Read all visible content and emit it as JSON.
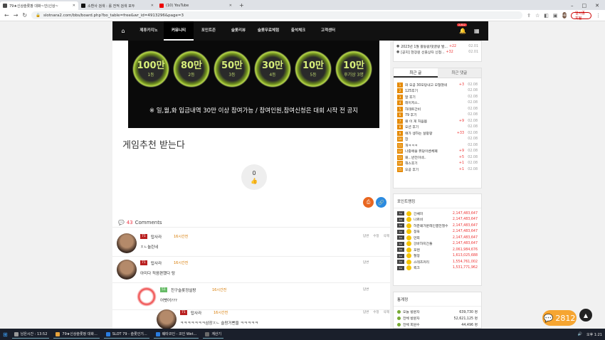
{
  "browser": {
    "tabs": [
      {
        "title": "79★신상슬롯팡 대화~인(신상~",
        "fav": "#4a4a4a",
        "active": true
      },
      {
        "title": "소환사 검색 : 롤 전적 검색 포두",
        "fav": "#111",
        "active": false
      },
      {
        "title": "(10) YouTube",
        "fav": "#e00",
        "active": false
      }
    ],
    "new_tab": "+",
    "url": "slotnara2.com/bbs/board.php?bo_table=free&wr_id=4913296&page=3",
    "profile": "HB",
    "pause_label": "일시중지됨"
  },
  "menu": {
    "home": "⌂",
    "items": [
      "제휴카지노",
      "커뮤니티",
      "포인트존",
      "슬롯리뷰",
      "슬롯무료체험",
      "출석체크",
      "고객센터"
    ],
    "active_index": 1,
    "bell_badge": "2,812",
    "grid": "▦"
  },
  "banner": {
    "coins": [
      {
        "amount": "100만",
        "rank": "1등"
      },
      {
        "amount": "80만",
        "rank": "2등"
      },
      {
        "amount": "50만",
        "rank": "3등"
      },
      {
        "amount": "30만",
        "rank": "4등"
      },
      {
        "amount": "10만",
        "rank": "5등"
      },
      {
        "amount": "10만",
        "rank": "후기상 3명"
      }
    ],
    "note": "※ 일,월,화 입금내역 30만 이상 참여가능 / 참여인원,참여신청은 대회 시작 전 공지"
  },
  "post": {
    "title": "게임추천 받는다",
    "like_count": "0"
  },
  "comments": {
    "count": "43",
    "label": "Comments",
    "items": [
      {
        "lvl": "71",
        "nick": "탑사라",
        "time": "16시간전",
        "text": "ㅈㄴ놀린네",
        "actions": [
          "답변",
          "수정",
          "삭제"
        ]
      },
      {
        "lvl": "71",
        "nick": "탑사라",
        "time": "16시간전",
        "text": "아미다 적음편했다 탕",
        "actions": [
          "답변"
        ]
      },
      {
        "lvl": "51",
        "nick": "친구슬롯정설팡",
        "time": "16시간전",
        "text": "어뻣어???",
        "actions": [
          "답변"
        ]
      },
      {
        "lvl": "71",
        "nick": "탑사라",
        "time": "16시간전",
        "text": "ㅋㅋㅋㅋㅋㅋㅋ삼장ㅈㄴ 슬랑거뻔을 ㅋㅋㅋㅋㅋ",
        "actions": [
          "답변",
          "수정",
          "삭제"
        ]
      }
    ]
  },
  "notices": [
    {
      "title": "2023년 1월 활동왕/댓글왕 발...",
      "count": "+22",
      "date": "02.01"
    },
    {
      "title": "[공지] 현장원 선출상자 신청...",
      "count": "+32",
      "date": "02.01"
    }
  ],
  "popular": {
    "tabs": [
      "최근 글",
      "최근 댓글"
    ],
    "items": [
      {
        "rank": "1",
        "title": "와 오공 30모탕내고 모형졌네",
        "count": "+3",
        "date": "02.08"
      },
      {
        "rank": "2",
        "title": "125후기",
        "count": "",
        "date": "02.08"
      },
      {
        "rank": "3",
        "title": "알 후기",
        "count": "",
        "date": "02.08"
      },
      {
        "rank": "4",
        "title": "레이저스..",
        "count": "",
        "date": "02.08"
      },
      {
        "rank": "5",
        "title": "하데트간비",
        "count": "",
        "date": "02.08"
      },
      {
        "rank": "6",
        "title": "79 후기",
        "count": "",
        "date": "02.08"
      },
      {
        "rank": "7",
        "title": "왜 이 게 처음봄",
        "count": "+9",
        "date": "02.08"
      },
      {
        "rank": "8",
        "title": "오션 후기",
        "count": "",
        "date": "02.08"
      },
      {
        "rank": "9",
        "title": "얘가 생하는 살팡팡",
        "count": "+33",
        "date": "02.08"
      },
      {
        "rank": "10",
        "title": "잡",
        "count": "",
        "date": "02.08"
      },
      {
        "rank": "11",
        "title": "개ㅋㅋㅋ",
        "count": "",
        "date": "02.08"
      },
      {
        "rank": "12",
        "title": "나중에쓸 뷰당이벤체폐",
        "count": "+9",
        "date": "02.08"
      },
      {
        "rank": "13",
        "title": "왜...반전이네..",
        "count": "+5",
        "date": "02.08"
      },
      {
        "rank": "14",
        "title": "해스후기",
        "count": "+1",
        "date": "02.08"
      },
      {
        "rank": "15",
        "title": "오공 후기",
        "count": "+1",
        "date": "02.08"
      }
    ]
  },
  "ranking": {
    "title": "포인트랭킹",
    "items": [
      {
        "lvl": "Lv.",
        "name": "간쌔미",
        "points": "2,147,483,647"
      },
      {
        "lvl": "Lv.",
        "name": "나르비",
        "points": "2,147,483,647"
      },
      {
        "lvl": "Lv.",
        "name": "허준왜가문레인결전철수",
        "points": "2,147,483,647"
      },
      {
        "lvl": "Lv.",
        "name": "정욱",
        "points": "2,147,483,647"
      },
      {
        "lvl": "Lv.",
        "name": "만희",
        "points": "2,147,483,647"
      },
      {
        "lvl": "Lv.",
        "name": "강바하지간둘",
        "points": "2,147,483,647"
      },
      {
        "lvl": "Lv.",
        "name": "포텐",
        "points": "2,061,984,676"
      },
      {
        "lvl": "Lv.",
        "name": "절정",
        "points": "1,613,025,688"
      },
      {
        "lvl": "Lv.",
        "name": "스테츠커리",
        "points": "1,554,761,002"
      },
      {
        "lvl": "Lv.",
        "name": "퀵크",
        "points": "1,531,771,962"
      }
    ]
  },
  "stats": {
    "title": "통계정",
    "items": [
      {
        "k": "오늘 방문자",
        "v": "639,730 명"
      },
      {
        "k": "전체 방문자",
        "v": "52,621,125 명"
      },
      {
        "k": "전체 회원수",
        "v": "44,496 명"
      }
    ]
  },
  "floating": {
    "chat_count": "2812",
    "top": "▲"
  },
  "taskbar": {
    "items": [
      "남은시간 : 13:52",
      "79★신상슬롯팡 대화...",
      "SLOT 79 - 슬롯인기...",
      "웨타코인 - 코인 Wet...",
      "계산기"
    ],
    "time": "오후 1:21"
  }
}
